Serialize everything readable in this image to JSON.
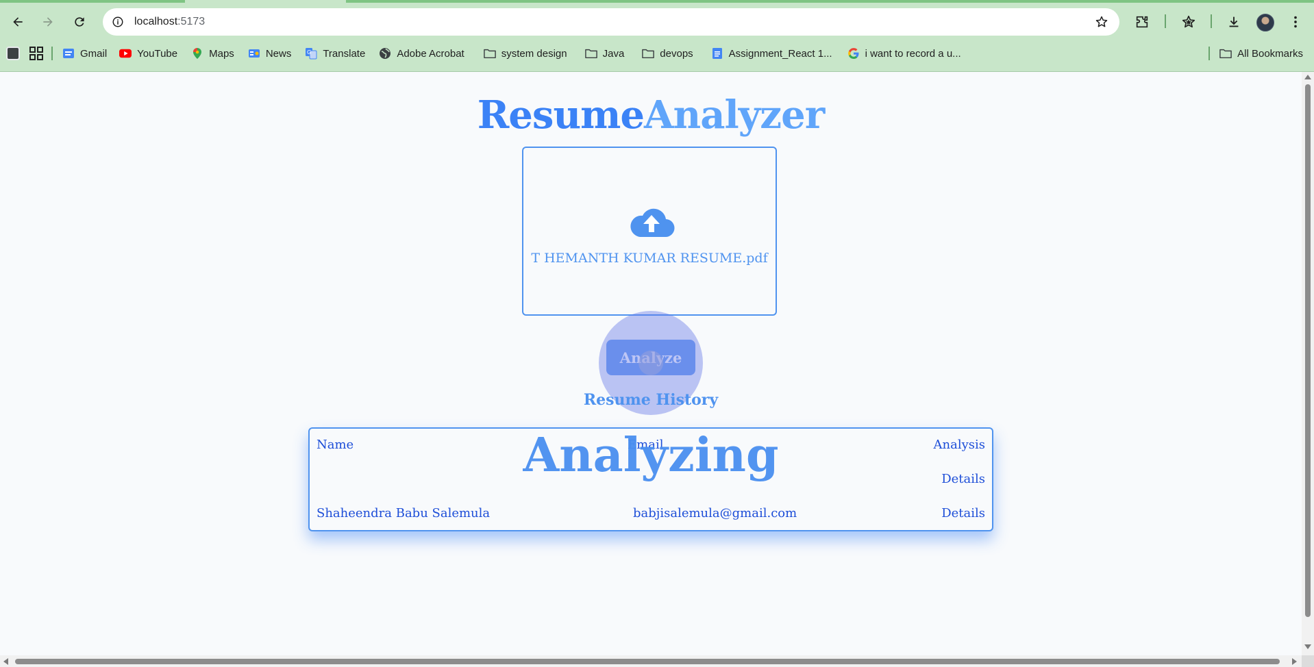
{
  "browser": {
    "url_host": "localhost",
    "url_port": ":5173",
    "bookmarks": [
      {
        "label": "Gmail",
        "icon": "gmail-icon"
      },
      {
        "label": "YouTube",
        "icon": "youtube-icon"
      },
      {
        "label": "Maps",
        "icon": "maps-icon"
      },
      {
        "label": "News",
        "icon": "news-icon"
      },
      {
        "label": "Translate",
        "icon": "translate-icon"
      },
      {
        "label": "Adobe Acrobat",
        "icon": "globe-icon"
      },
      {
        "label": "system design",
        "icon": "folder-icon"
      },
      {
        "label": "Java",
        "icon": "folder-icon"
      },
      {
        "label": "devops",
        "icon": "folder-icon"
      },
      {
        "label": "Assignment_React 1...",
        "icon": "docs-icon"
      },
      {
        "label": "i want to record a u...",
        "icon": "google-icon"
      }
    ],
    "all_bookmarks": "All Bookmarks"
  },
  "app": {
    "title_part1": "Resume",
    "title_part2": "Analyzer",
    "uploaded_file": "T HEMANTH KUMAR RESUME.pdf",
    "analyze_label": "Analyze",
    "overlay_text": "Analyzing",
    "history_title": "Resume History",
    "table": {
      "headers": {
        "name": "Name",
        "email": "Email",
        "analysis": "Analysis"
      },
      "rows": [
        {
          "name": "",
          "email": "",
          "action": "Details"
        },
        {
          "name": "Shaheendra Babu Salemula",
          "email": "babjisalemula@gmail.com",
          "action": "Details"
        }
      ]
    }
  },
  "colors": {
    "chrome_bg": "#c8e6c9",
    "primary": "#3b82f6",
    "primary_light": "#60a5fa",
    "table_text": "#1d4ed8",
    "spinner": "#6376e6"
  }
}
